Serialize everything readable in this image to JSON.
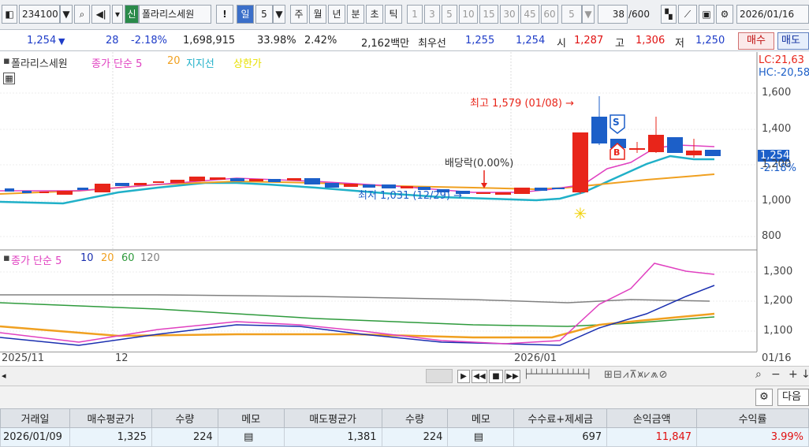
{
  "toolbar": {
    "code": "234100",
    "credit_badge": "신",
    "name": "폴라리스세원",
    "period_day": "일",
    "period_num": "5",
    "periods": [
      "주",
      "월",
      "년",
      "분",
      "초",
      "틱"
    ],
    "minute_opts": [
      "1",
      "3",
      "5",
      "10",
      "15",
      "30",
      "45",
      "60"
    ],
    "interval_value": "5",
    "count_value": "38",
    "count_max": "/600",
    "date": "2026/01/16"
  },
  "info": {
    "price": "1,254",
    "change": "28",
    "change_pct": "-2.18%",
    "volume": "1,698,915",
    "vol_ratio": "33.98%",
    "turnover": "2.42%",
    "amount": "2,162백만",
    "ask_label": "최우선",
    "ask": "1,255",
    "bid": "1,254",
    "open_label": "시",
    "open": "1,287",
    "high_label": "고",
    "high": "1,306",
    "low_label": "저",
    "low": "1,250",
    "buy_button": "매수",
    "sell_button": "매도"
  },
  "legend_top": {
    "name": "폴라리스세원",
    "ma": "종가 단순 5",
    "ma20": "20",
    "support": "지지선",
    "limit": "상한가"
  },
  "legend_bottom": {
    "ma": "종가 단순 5",
    "ma10": "10",
    "ma20": "20",
    "ma60": "60",
    "ma120": "120"
  },
  "annotations": {
    "high": "최고 1,579 (01/08) →",
    "low": "최저 1,031 (12/29) →",
    "dividend": "배당락(0.00%)",
    "lc": "LC:21,63",
    "hc": "HC:-20,58",
    "marker_s": "S",
    "marker_b": "B"
  },
  "price_axis": {
    "ticks": [
      "1,600",
      "1,400",
      "1,200",
      "1,000",
      "800"
    ],
    "current": "1,254",
    "current_pct": "-2.18%"
  },
  "ma_axis": {
    "ticks": [
      "1,300",
      "1,200",
      "1,100"
    ]
  },
  "x_axis": {
    "labels": [
      "2025/11",
      "12",
      "2026/01"
    ],
    "right_label": "01/16"
  },
  "panel2": {
    "next_button": "다음"
  },
  "trade_table": {
    "headers": [
      "거래일",
      "매수평균가",
      "수량",
      "메모",
      "매도평균가",
      "수량",
      "메모",
      "수수료+제세금",
      "손익금액",
      "수익률"
    ],
    "row": [
      "2026/01/09",
      "1,325",
      "224",
      "",
      "1,381",
      "224",
      "",
      "697",
      "11,847",
      "3.99%"
    ]
  },
  "colors": {
    "up": "#e8251a",
    "down": "#1c5fc8",
    "ma5": "#e040c0",
    "ma10": "#1a2fb0",
    "ma20": "#f0a020",
    "ma60": "#2e9a3c",
    "ma120": "#808080",
    "support": "#20b0c8",
    "limit": "#e8e000"
  }
}
